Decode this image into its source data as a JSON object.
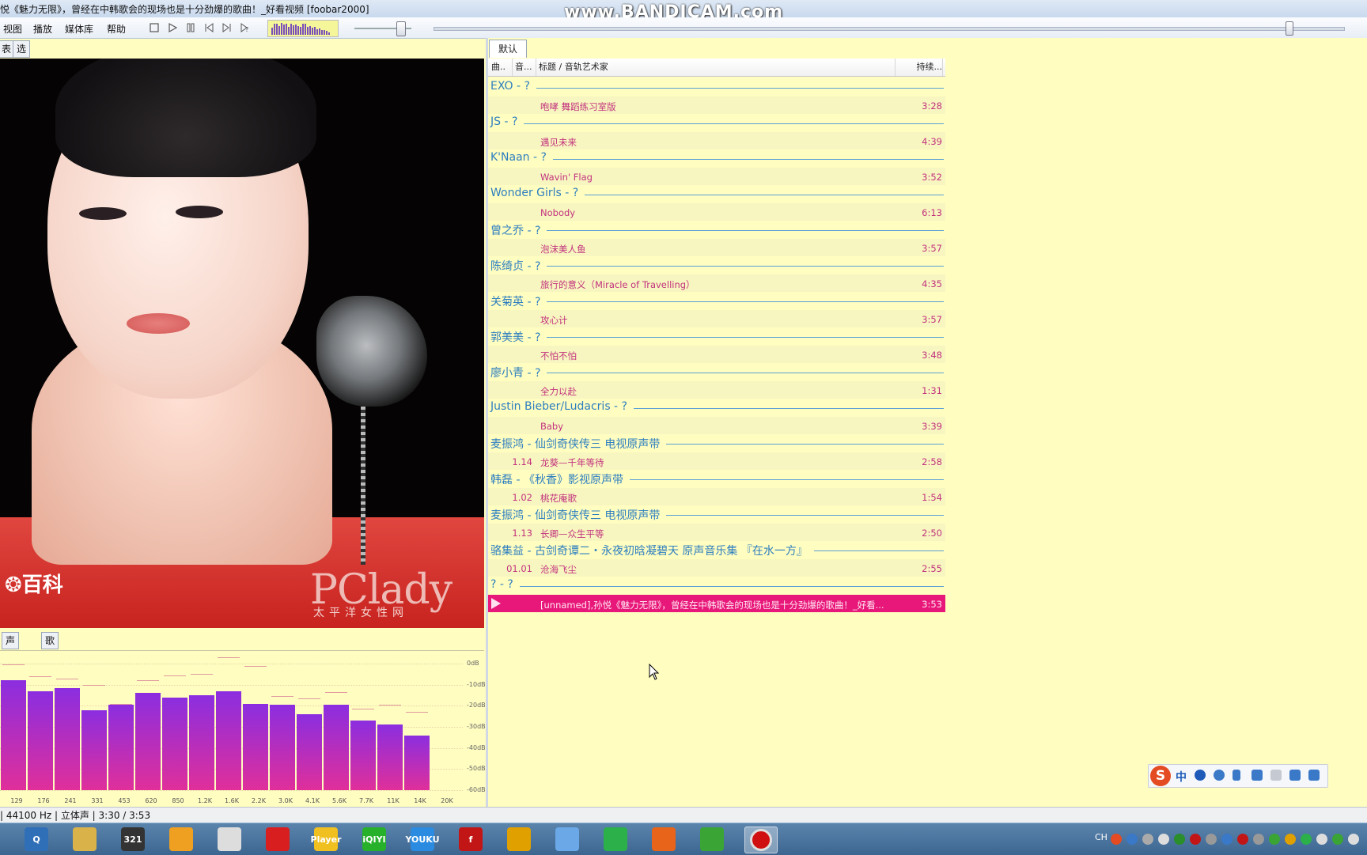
{
  "window": {
    "title": "悦《魅力无限》，曾经在中韩歌会的现场也是十分劲爆的歌曲！_好看视频  [foobar2000]",
    "watermark": "www.BANDICAM.com"
  },
  "menu": [
    "视图",
    "播放",
    "媒体库",
    "帮助"
  ],
  "toolbar": {
    "buttons": [
      "stop-icon",
      "play-icon",
      "pause-icon",
      "previous-icon",
      "next-icon",
      "random-icon"
    ],
    "viz_levels": [
      0.55,
      0.85,
      0.9,
      0.7,
      0.95,
      0.8,
      0.85,
      0.6,
      0.9,
      0.75,
      0.8,
      0.7,
      0.65,
      0.9,
      0.85,
      0.6,
      0.7,
      0.55,
      0.65,
      0.45,
      0.5,
      0.4,
      0.35,
      0.3,
      0.2
    ],
    "volume_level": 0.8,
    "seek_progress": 0.94
  },
  "left_tabs": [
    "表",
    "选择项属性"
  ],
  "album_art": {
    "logo_left": "百科",
    "logo_right": "PClady",
    "logo_right_sub": "太平洋女性网"
  },
  "bottom_tabs": [
    "声量计",
    "歌词"
  ],
  "spectrum": {
    "db_labels": [
      "0dB",
      "-10dB",
      "-20dB",
      "-30dB",
      "-40dB",
      "-50dB",
      "-60dB"
    ],
    "freq_labels": [
      "129",
      "176",
      "241",
      "331",
      "453",
      "620",
      "850",
      "1.2K",
      "1.6K",
      "2.2K",
      "3.0K",
      "4.1K",
      "5.6K",
      "7.7K",
      "11K",
      "14K",
      "20K"
    ],
    "levels_db": [
      -8,
      -13,
      -11.5,
      -22,
      -19.5,
      -14,
      -16,
      -15,
      -13,
      -19,
      -19.5,
      -24,
      -19.5,
      -27,
      -29,
      -34
    ],
    "peaks_db": [
      -0.5,
      -6,
      -7,
      -10,
      -19,
      -8,
      -5.5,
      -5,
      3,
      -1,
      -15.5,
      -16.5,
      -13.5,
      -21.5,
      -19.5,
      -23
    ]
  },
  "playlist": {
    "tab": "默认",
    "columns": [
      "曲..",
      "音...",
      "标题 / 音轨艺术家",
      "持续..."
    ],
    "groups": [
      {
        "header": "EXO - ?",
        "tracks": [
          {
            "no": "",
            "title": "咆哮 舞蹈练习室版",
            "duration": "3:28"
          }
        ]
      },
      {
        "header": "JS - ?",
        "tracks": [
          {
            "no": "",
            "title": "遇见未来",
            "duration": "4:39"
          }
        ]
      },
      {
        "header": "K'Naan - ?",
        "tracks": [
          {
            "no": "",
            "title": "Wavin' Flag",
            "duration": "3:52"
          }
        ]
      },
      {
        "header": "Wonder Girls - ?",
        "tracks": [
          {
            "no": "",
            "title": "Nobody",
            "duration": "6:13"
          }
        ]
      },
      {
        "header": "曾之乔 - ?",
        "tracks": [
          {
            "no": "",
            "title": "泡沫美人鱼",
            "duration": "3:57"
          }
        ]
      },
      {
        "header": "陈绮贞 - ?",
        "tracks": [
          {
            "no": "",
            "title": "旅行的意义（Miracle of Travelling）",
            "duration": "4:35"
          }
        ]
      },
      {
        "header": "关菊英 - ?",
        "tracks": [
          {
            "no": "",
            "title": "攻心计",
            "duration": "3:57"
          }
        ]
      },
      {
        "header": "郭美美 - ?",
        "tracks": [
          {
            "no": "",
            "title": "不怕不怕",
            "duration": "3:48"
          }
        ]
      },
      {
        "header": "廖小青 - ?",
        "tracks": [
          {
            "no": "",
            "title": "全力以赴",
            "duration": "1:31"
          }
        ]
      },
      {
        "header": "Justin Bieber/Ludacris - ?",
        "tracks": [
          {
            "no": "",
            "title": "Baby",
            "duration": "3:39"
          }
        ]
      },
      {
        "header": "麦振鸿 - 仙剑奇侠传三 电视原声带",
        "tracks": [
          {
            "no": "1.14",
            "title": "龙葵—千年等待",
            "duration": "2:58"
          }
        ]
      },
      {
        "header": "韩磊 - 《秋香》影视原声带",
        "tracks": [
          {
            "no": "1.02",
            "title": "桃花庵歌",
            "duration": "1:54"
          }
        ]
      },
      {
        "header": "麦振鸿 - 仙剑奇侠传三 电视原声带",
        "tracks": [
          {
            "no": "1.13",
            "title": "长卿—众生平等",
            "duration": "2:50"
          }
        ]
      },
      {
        "header": "骆集益 - 古剑奇谭二・永夜初晗凝碧天 原声音乐集 『在水一方』",
        "tracks": [
          {
            "no": "01.01",
            "title": "沧海飞尘",
            "duration": "2:55"
          }
        ]
      },
      {
        "header": "? - ?",
        "tracks": [
          {
            "no": "",
            "title": "[unnamed],孙悦《魅力无限》，曾经在中韩歌会的现场也是十分劲爆的歌曲！_好看...",
            "duration": "3:53",
            "playing": true
          }
        ]
      }
    ]
  },
  "status": "| 44100 Hz | 立体声 | 3:30 / 3:53",
  "ime": {
    "zh": "中",
    "logo": "S"
  },
  "taskbar": {
    "apps": [
      {
        "name": "search-app",
        "color": "#2f6fb8",
        "label": "Q"
      },
      {
        "name": "file-explorer-app",
        "color": "#d9b24a",
        "label": ""
      },
      {
        "name": "media-player-classic-app",
        "color": "#333",
        "label": "321"
      },
      {
        "name": "foobar-headphones-app",
        "color": "#f0a020",
        "label": ""
      },
      {
        "name": "alien-app",
        "color": "#ddd",
        "label": ""
      },
      {
        "name": "netease-music-app",
        "color": "#d81e1e",
        "label": ""
      },
      {
        "name": "potplayer-app",
        "color": "#f0c020",
        "label": "Player"
      },
      {
        "name": "iqiyi-app",
        "color": "#27b02a",
        "label": "iQIYI"
      },
      {
        "name": "youku-app",
        "color": "#2b8be0",
        "label": "YOUKU"
      },
      {
        "name": "flash-app",
        "color": "#c21616",
        "label": "f"
      },
      {
        "name": "chrome-app",
        "color": "#e0a000",
        "label": ""
      },
      {
        "name": "bird-app",
        "color": "#6aa8e8",
        "label": ""
      },
      {
        "name": "play-app",
        "color": "#2bb04a",
        "label": ""
      },
      {
        "name": "firefox-app",
        "color": "#e8641a",
        "label": ""
      },
      {
        "name": "green-sync-app",
        "color": "#3aa535",
        "label": ""
      },
      {
        "name": "bandicam-app",
        "color": "#222",
        "label": ""
      }
    ],
    "tray_lang": "CH"
  }
}
